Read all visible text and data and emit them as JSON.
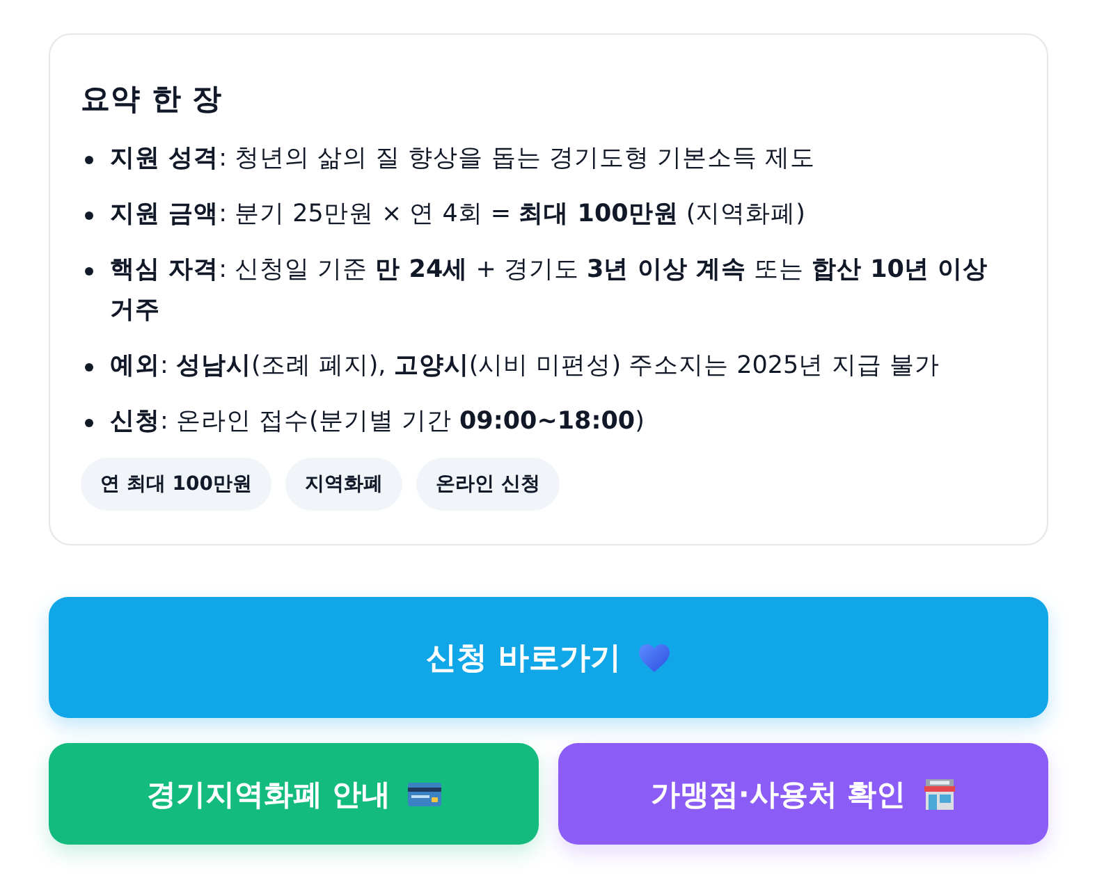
{
  "summary": {
    "title": "요약 한 장",
    "items": [
      "**지원 성격**: 청년의 삶의 질 향상을 돕는 경기도형 기본소득 제도",
      "**지원 금액**: 분기 25만원 × 연 4회 = **최대 100만원** (지역화폐)",
      "**핵심 자격**: 신청일 기준 **만 24세** + 경기도 **3년 이상 계속** 또는 **합산 10년 이상 거주**",
      "**예외**: **성남시**(조례 폐지), **고양시**(시비 미편성) 주소지는 2025년 지급 불가",
      "**신청**: 온라인 접수(분기별 기간 **09:00~18:00**)"
    ],
    "tags": [
      "연 최대 100만원",
      "지역화폐",
      "온라인 신청"
    ]
  },
  "buttons": [
    {
      "label": "신청 바로가기",
      "kind": "apply"
    },
    {
      "label": "경기지역화폐 안내",
      "kind": "currency"
    },
    {
      "label": "가맹점·사용처 확인",
      "kind": "merchants"
    }
  ]
}
